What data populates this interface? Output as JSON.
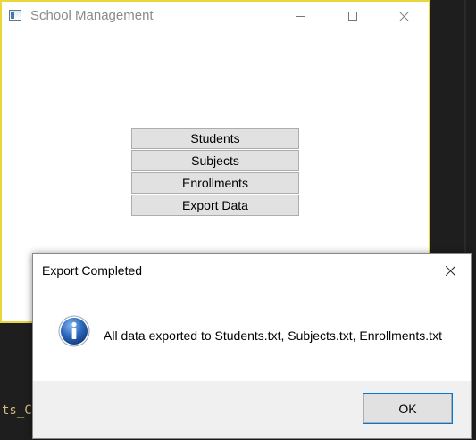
{
  "main_window": {
    "title": "School Management",
    "app_icon": "window-app-icon",
    "caption_icons": [
      "minimize-icon",
      "maximize-icon",
      "close-icon"
    ],
    "menu_buttons": [
      {
        "label": "Students"
      },
      {
        "label": "Subjects"
      },
      {
        "label": "Enrollments"
      },
      {
        "label": "Export Data"
      }
    ]
  },
  "dialog": {
    "title": "Export Completed",
    "icon": "info-icon",
    "message": "All data exported to Students.txt, Subjects.txt, Enrollments.txt",
    "ok_label": "OK"
  },
  "background": {
    "code_fragment": "ts_C"
  },
  "colors": {
    "window_border_focus": "#e8d63a",
    "button_face": "#e1e1e1",
    "button_border": "#adadad",
    "default_button_outline": "#0078d7",
    "info_icon_blue": "#2d6cc0",
    "editor_background": "#1e1e1e",
    "dialog_footer": "#f0f0f0"
  }
}
